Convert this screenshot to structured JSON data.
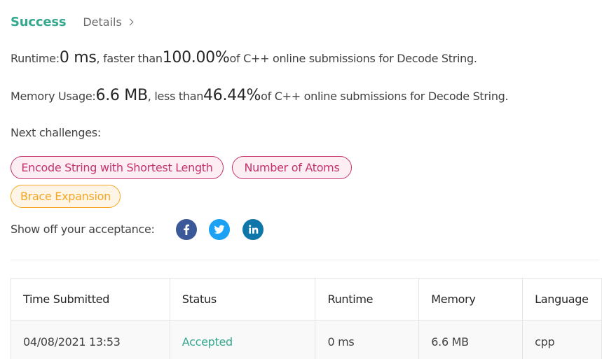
{
  "header": {
    "status": "Success",
    "details_label": "Details"
  },
  "runtime": {
    "prefix": "Runtime: ",
    "value": "0 ms",
    "mid": ", faster than ",
    "percent": "100.00%",
    "suffix": " of C++ online submissions for Decode String."
  },
  "memory": {
    "prefix": "Memory Usage: ",
    "value": "6.6 MB",
    "mid": ", less than ",
    "percent": "46.44%",
    "suffix": " of C++ online submissions for Decode String."
  },
  "next_challenges": {
    "label": "Next challenges:",
    "items": [
      {
        "label": "Encode String with Shortest Length",
        "difficulty": "medium"
      },
      {
        "label": "Number of Atoms",
        "difficulty": "medium"
      },
      {
        "label": "Brace Expansion",
        "difficulty": "easy"
      }
    ]
  },
  "share": {
    "label": "Show off your acceptance:",
    "networks": [
      {
        "icon": "facebook-icon",
        "color": "#3b5998"
      },
      {
        "icon": "twitter-icon",
        "color": "#1da1f2"
      },
      {
        "icon": "linkedin-icon",
        "color": "#0e76a8"
      }
    ]
  },
  "submissions_table": {
    "columns": [
      "Time Submitted",
      "Status",
      "Runtime",
      "Memory",
      "Language"
    ],
    "rows": [
      [
        "04/08/2021 13:53",
        "Accepted",
        "0 ms",
        "6.6 MB",
        "cpp"
      ]
    ]
  },
  "colors": {
    "success": "#36a88f",
    "medium": "#c5336d",
    "easy": "#f5a623"
  }
}
